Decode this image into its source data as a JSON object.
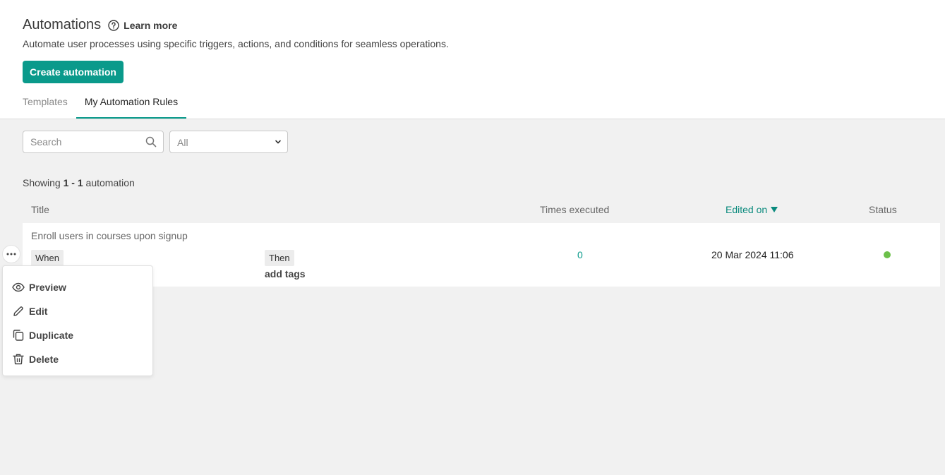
{
  "header": {
    "title": "Automations",
    "learn_more": "Learn more",
    "subtitle": "Automate user processes using specific triggers, actions, and conditions for seamless operations.",
    "create_button": "Create automation"
  },
  "tabs": [
    {
      "label": "Templates",
      "active": false
    },
    {
      "label": "My Automation Rules",
      "active": true
    }
  ],
  "filters": {
    "search_placeholder": "Search",
    "search_value": "",
    "select_value": "All"
  },
  "summary": {
    "prefix": "Showing ",
    "range_start": "1",
    "separator": " - ",
    "range_end": "1",
    "suffix": " automation"
  },
  "table": {
    "columns": {
      "title": "Title",
      "times_executed": "Times executed",
      "edited_on": "Edited on",
      "status": "Status"
    },
    "rows": [
      {
        "title": "Enroll users in courses upon signup",
        "when_label": "When",
        "then_label": "Then",
        "action": "add tags",
        "times_executed": "0",
        "edited_on": "20 Mar 2024 11:06",
        "status_color": "#6cc04a"
      }
    ]
  },
  "context_menu": {
    "items": [
      {
        "label": "Preview",
        "icon": "eye-icon"
      },
      {
        "label": "Edit",
        "icon": "pencil-icon"
      },
      {
        "label": "Duplicate",
        "icon": "duplicate-icon"
      },
      {
        "label": "Delete",
        "icon": "trash-icon"
      }
    ]
  },
  "colors": {
    "accent": "#0a9a8b",
    "status_active": "#6cc04a",
    "background": "#f1f1f1"
  }
}
